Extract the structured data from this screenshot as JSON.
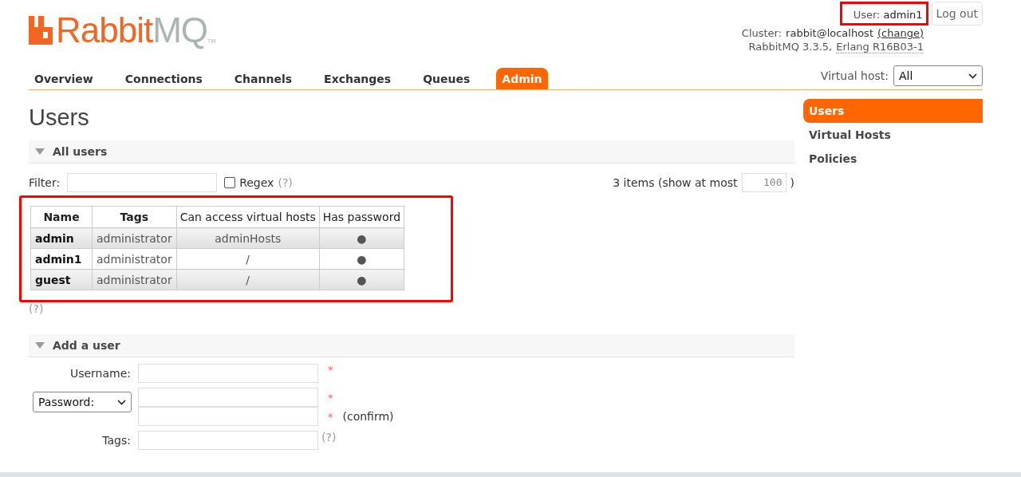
{
  "header": {
    "logo_main": "Rabbit",
    "logo_accent": "MQ",
    "logo_tm": "TM",
    "user_label": "User:",
    "user": "admin1",
    "logout": "Log out",
    "cluster_label": "Cluster:",
    "cluster": "rabbit@localhost",
    "change": "(change)",
    "version": "RabbitMQ 3.3.5,",
    "erlang": "Erlang R16B03-1",
    "vhost_label": "Virtual host:",
    "vhost_value": "All"
  },
  "tabs": [
    {
      "label": "Overview",
      "selected": false
    },
    {
      "label": "Connections",
      "selected": false
    },
    {
      "label": "Channels",
      "selected": false
    },
    {
      "label": "Exchanges",
      "selected": false
    },
    {
      "label": "Queues",
      "selected": false
    },
    {
      "label": "Admin",
      "selected": true
    }
  ],
  "page_title": "Users",
  "sidebar": {
    "items": [
      {
        "label": "Users",
        "selected": true
      },
      {
        "label": "Virtual Hosts",
        "selected": false
      },
      {
        "label": "Policies",
        "selected": false
      }
    ]
  },
  "all_users": {
    "title": "All users",
    "filter_label": "Filter:",
    "regex_label": "Regex",
    "regex_checked": false,
    "help": "(?)",
    "items_text": "3 items (show at most",
    "max_value": "100",
    "items_close": ")",
    "table": {
      "columns": [
        "Name",
        "Tags",
        "Can access virtual hosts",
        "Has password"
      ],
      "rows": [
        [
          "admin",
          "administrator",
          "adminHosts",
          "●"
        ],
        [
          "admin1",
          "administrator",
          "/",
          "●"
        ],
        [
          "guest",
          "administrator",
          "/",
          "●"
        ]
      ]
    },
    "footer_help": "(?)"
  },
  "add_user": {
    "title": "Add a user",
    "username_label": "Username:",
    "password_select": "Password:",
    "required": "*",
    "confirm": "(confirm)",
    "tags_label": "Tags:",
    "tags_help": "(?)"
  }
}
